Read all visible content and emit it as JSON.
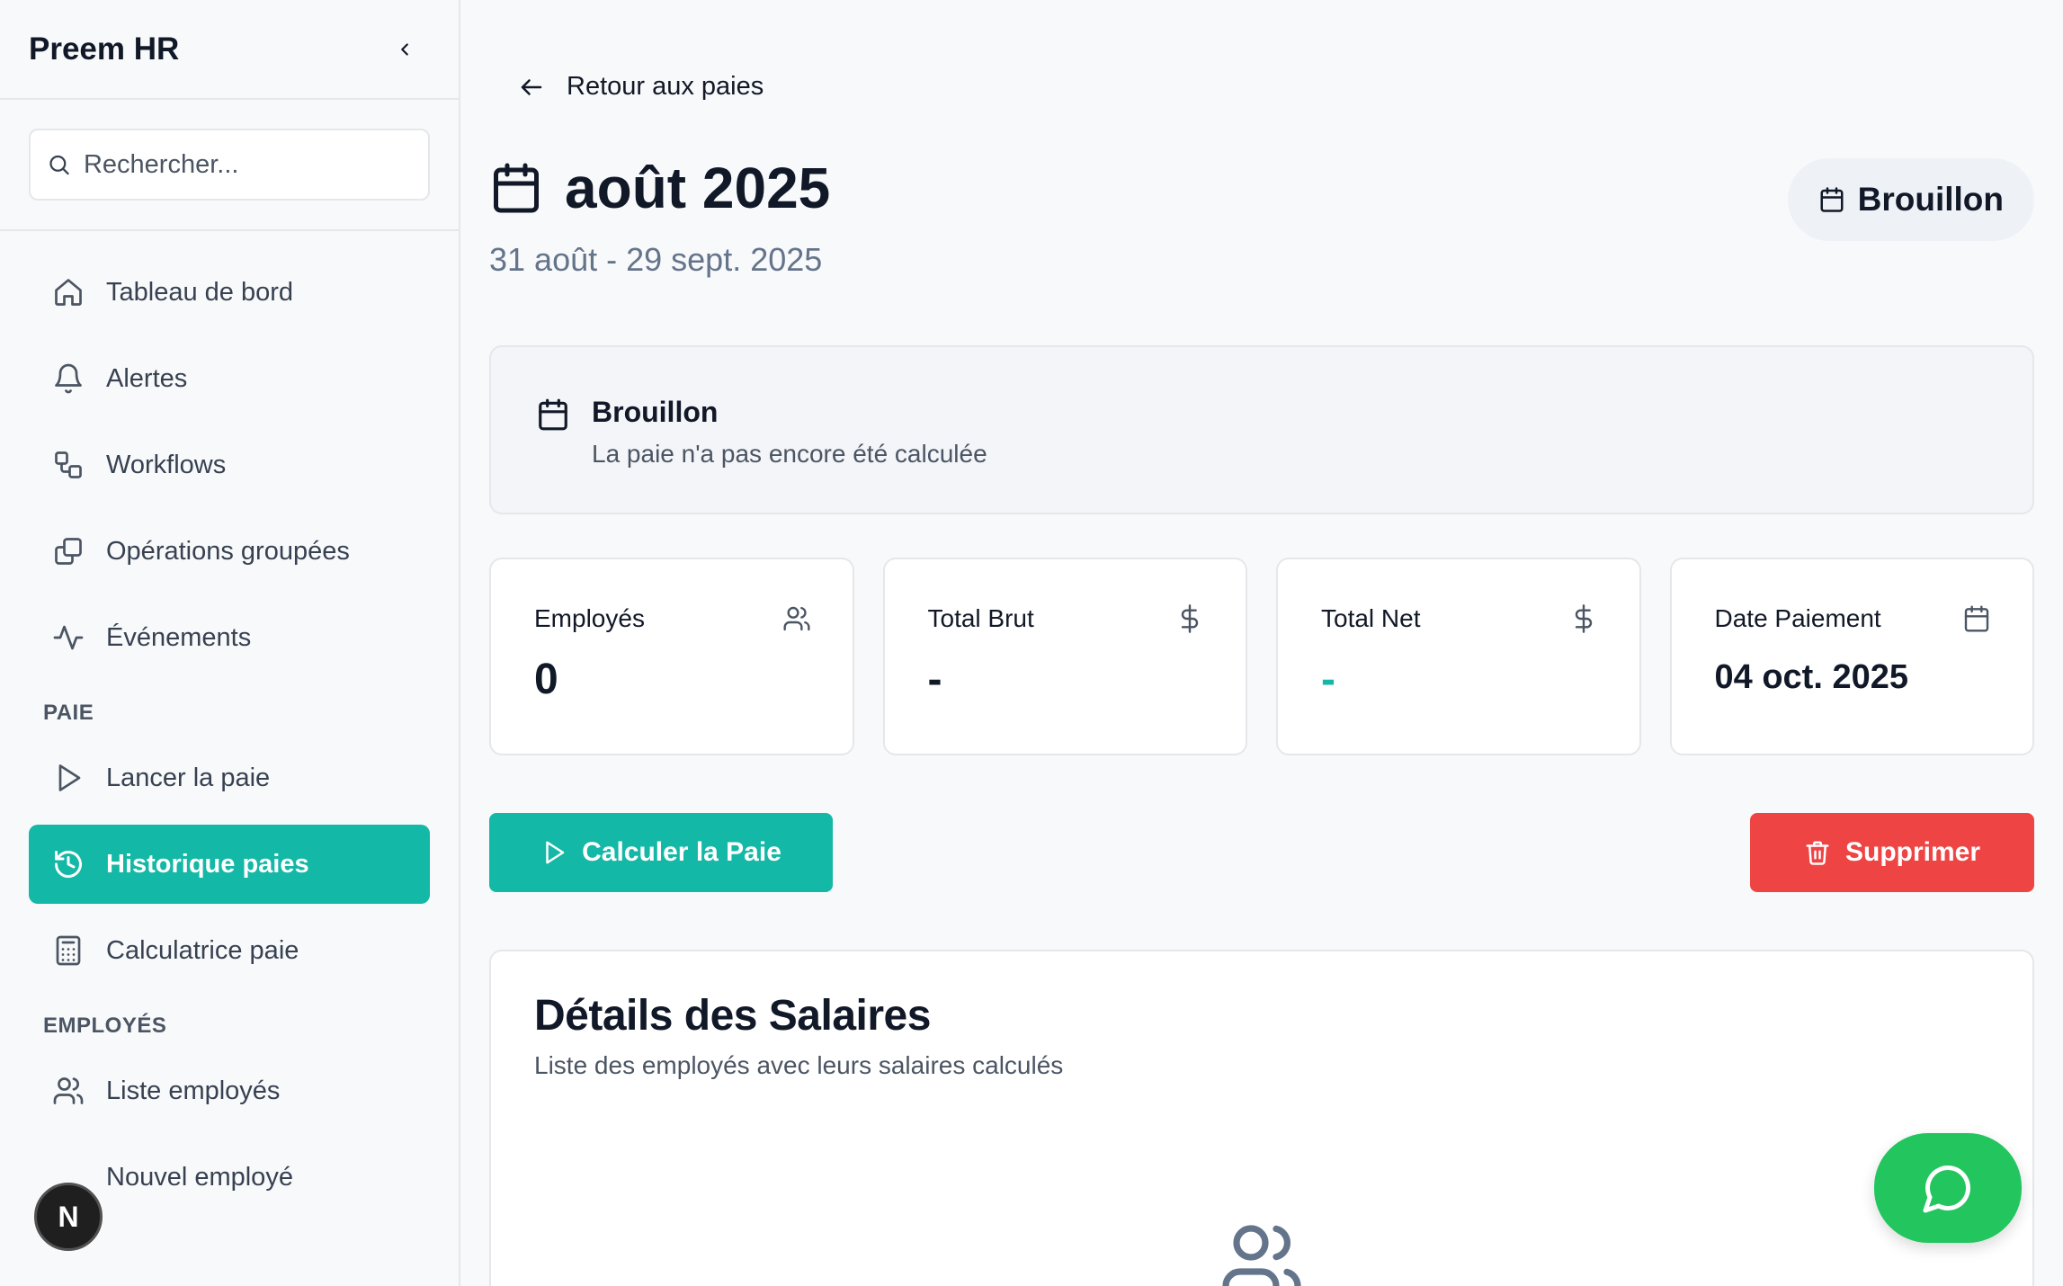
{
  "app": {
    "name": "Preem HR"
  },
  "search": {
    "placeholder": "Rechercher..."
  },
  "sidebar": {
    "items": [
      {
        "label": "Tableau de bord",
        "icon": "home-icon"
      },
      {
        "label": "Alertes",
        "icon": "bell-icon"
      },
      {
        "label": "Workflows",
        "icon": "workflow-icon"
      },
      {
        "label": "Opérations groupées",
        "icon": "copy-icon"
      },
      {
        "label": "Événements",
        "icon": "activity-icon"
      }
    ],
    "section_paie": "PAIE",
    "paie_items": [
      {
        "label": "Lancer la paie",
        "icon": "play-icon"
      },
      {
        "label": "Historique paies",
        "icon": "history-icon",
        "active": true
      },
      {
        "label": "Calculatrice paie",
        "icon": "calculator-icon"
      }
    ],
    "section_employes": "EMPLOYÉS",
    "employe_items": [
      {
        "label": "Liste employés",
        "icon": "users-icon"
      },
      {
        "label": "Nouvel employé",
        "icon": "user-plus-icon"
      }
    ]
  },
  "avatar": {
    "initial": "N"
  },
  "main": {
    "back_label": "Retour aux paies",
    "title": "août 2025",
    "period": "31 août - 29 sept. 2025",
    "status": "Brouillon",
    "info": {
      "title": "Brouillon",
      "description": "La paie n'a pas encore été calculée"
    },
    "stats": [
      {
        "label": "Employés",
        "value": "0",
        "icon": "users-icon"
      },
      {
        "label": "Total Brut",
        "value": "-",
        "icon": "dollar-icon"
      },
      {
        "label": "Total Net",
        "value": "-",
        "icon": "dollar-icon"
      },
      {
        "label": "Date Paiement",
        "value": "04 oct. 2025",
        "icon": "calendar-icon"
      }
    ],
    "calc_button": "Calculer la Paie",
    "delete_button": "Supprimer",
    "details": {
      "title": "Détails des Salaires",
      "subtitle": "Liste des employés avec leurs salaires calculés"
    }
  },
  "colors": {
    "accent": "#14b8a6",
    "danger": "#ef4444",
    "chat": "#22c55e"
  }
}
